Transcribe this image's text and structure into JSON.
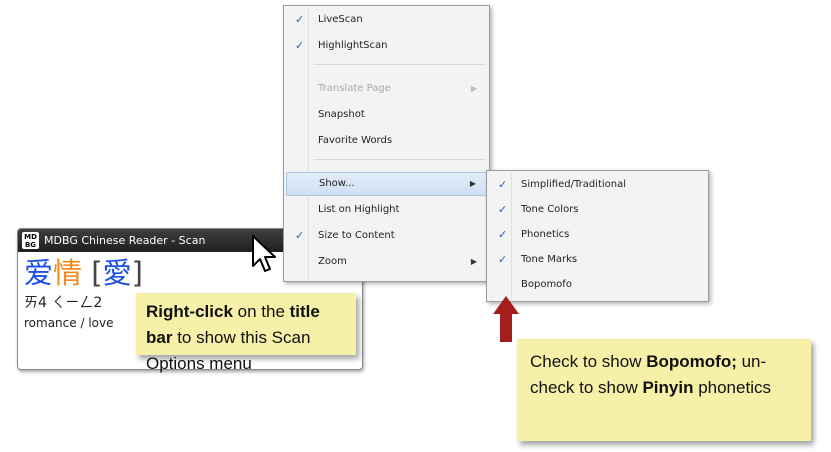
{
  "scan_window": {
    "logo_top": "MD",
    "logo_bottom": "BG",
    "title": "MDBG Chinese Reader - Scan",
    "word_simplified_1": "爱",
    "word_simplified_2": "情",
    "bracket_open": "[",
    "word_traditional": "愛",
    "bracket_close": "]",
    "bopomofo": "ㄞ4 ㄑㄧㄥ2",
    "definition": "romance / love"
  },
  "menu": {
    "items": [
      {
        "label": "LiveScan",
        "checked": true
      },
      {
        "label": "HighlightScan",
        "checked": true
      },
      {
        "label": "Translate Page",
        "disabled": true,
        "submenu": true
      },
      {
        "label": "Snapshot"
      },
      {
        "label": "Favorite Words"
      },
      {
        "label": "Show...",
        "submenu": true,
        "highlighted": true
      },
      {
        "label": "List on Highlight"
      },
      {
        "label": "Size to Content",
        "checked": true
      },
      {
        "label": "Zoom",
        "submenu": true
      }
    ]
  },
  "submenu": {
    "items": [
      {
        "label": "Simplified/Traditional",
        "checked": true
      },
      {
        "label": "Tone Colors",
        "checked": true
      },
      {
        "label": "Phonetics",
        "checked": true
      },
      {
        "label": "Tone Marks",
        "checked": true
      },
      {
        "label": "Bopomofo",
        "checked": false
      }
    ]
  },
  "callout_title_bar": {
    "part1": "Right-click",
    "part2": " on the ",
    "part3": "title bar",
    "part4": " to show this Scan Options menu"
  },
  "callout_bopomofo": {
    "part1": "Check to show ",
    "part2": "Bopomofo;",
    "part3": " un-check to show ",
    "part4": "Pinyin",
    "part5": " phonetics"
  },
  "glyphs": {
    "check": "✓",
    "submenu_arrow": "▶"
  },
  "colors": {
    "callout_bg": "#f6f0a8",
    "arrow": "#a51e1e",
    "hanzi_blue": "#1d4fe8",
    "hanzi_orange": "#f28a1d"
  }
}
